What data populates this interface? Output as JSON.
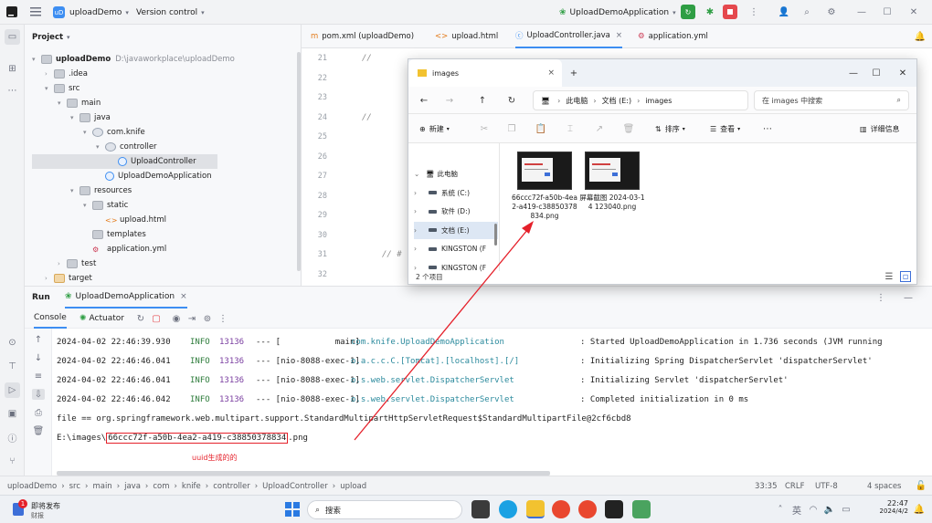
{
  "titlebar": {
    "project_badge": "uD",
    "project_name": "uploadDemo",
    "version_control": "Version control",
    "run_config": "UploadDemoApplication"
  },
  "project_panel": {
    "title": "Project",
    "tree": [
      {
        "label": "uploadDemo",
        "path": "D:\\javaworkplace\\uploadDemo",
        "kind": "folder"
      },
      {
        "label": ".idea",
        "kind": "folder"
      },
      {
        "label": "src",
        "kind": "folder"
      },
      {
        "label": "main",
        "kind": "folder"
      },
      {
        "label": "java",
        "kind": "folder"
      },
      {
        "label": "com.knife",
        "kind": "package"
      },
      {
        "label": "controller",
        "kind": "package"
      },
      {
        "label": "UploadController",
        "kind": "class"
      },
      {
        "label": "UploadDemoApplication",
        "kind": "class"
      },
      {
        "label": "resources",
        "kind": "folder"
      },
      {
        "label": "static",
        "kind": "folder"
      },
      {
        "label": "upload.html",
        "kind": "html"
      },
      {
        "label": "templates",
        "kind": "folder"
      },
      {
        "label": "application.yml",
        "kind": "yml"
      },
      {
        "label": "test",
        "kind": "folder"
      },
      {
        "label": "target",
        "kind": "folder"
      }
    ]
  },
  "editor_tabs": [
    {
      "label": "pom.xml (uploadDemo)",
      "active": false
    },
    {
      "label": "upload.html",
      "active": false
    },
    {
      "label": "UploadController.java",
      "active": true
    },
    {
      "label": "application.yml",
      "active": false
    }
  ],
  "editor": {
    "lines": [
      {
        "num": "21",
        "code": "//"
      },
      {
        "num": "22",
        "code": ""
      },
      {
        "num": "23",
        "code": ""
      },
      {
        "num": "24",
        "code": "//"
      },
      {
        "num": "25",
        "code": ""
      },
      {
        "num": "26",
        "code": ""
      },
      {
        "num": "27",
        "code": ""
      },
      {
        "num": "28",
        "code": ""
      },
      {
        "num": "29",
        "code": ""
      },
      {
        "num": "30",
        "code": ""
      },
      {
        "num": "31",
        "code": "// #"
      },
      {
        "num": "32",
        "code": ""
      }
    ]
  },
  "run_panel": {
    "title": "Run",
    "config_tab": "UploadDemoApplication",
    "console_tab": "Console",
    "actuator_tab": "Actuator",
    "logs": [
      {
        "time": "2024-04-02 22:46:39.930",
        "level": "INFO",
        "pid": "13136",
        "sep": "--- [",
        "thread": "           main]",
        "logger": "com.knife.UploadDemoApplication",
        "msg": ": Started UploadDemoApplication in 1.736 seconds (JVM running"
      },
      {
        "time": "2024-04-02 22:46:46.041",
        "level": "INFO",
        "pid": "13136",
        "sep": "--- [",
        "thread": "nio-8088-exec-1]",
        "logger": "o.a.c.c.C.[Tomcat].[localhost].[/]",
        "msg": ": Initializing Spring DispatcherServlet 'dispatcherServlet'"
      },
      {
        "time": "2024-04-02 22:46:46.041",
        "level": "INFO",
        "pid": "13136",
        "sep": "--- [",
        "thread": "nio-8088-exec-1]",
        "logger": "o.s.web.servlet.DispatcherServlet",
        "msg": ": Initializing Servlet 'dispatcherServlet'"
      },
      {
        "time": "2024-04-02 22:46:46.042",
        "level": "INFO",
        "pid": "13136",
        "sep": "--- [",
        "thread": "nio-8088-exec-1]",
        "logger": "o.s.web.servlet.DispatcherServlet",
        "msg": ": Completed initialization in 0 ms"
      }
    ],
    "file_line": "file == org.springframework.web.multipart.support.StandardMultipartHttpServletRequest$StandardMultipartFile@2cf6cbd8",
    "path_prefix": "E:\\images\\",
    "path_uuid": "66ccc72f-a50b-4ea2-a419-c38850378834",
    "path_ext": ".png",
    "annotation": "uuid生成的的"
  },
  "statusbar": {
    "breadcrumbs": [
      "uploadDemo",
      "src",
      "main",
      "java",
      "com",
      "knife",
      "controller",
      "UploadController",
      "upload"
    ],
    "position": "33:35",
    "line_ending": "CRLF",
    "encoding": "UTF-8",
    "indent": "4 spaces"
  },
  "taskbar": {
    "weather_title": "即将发布",
    "weather_sub": "财报",
    "search": "搜索",
    "time": "22:47",
    "date": "2024/4/2",
    "notification_count": "1"
  },
  "explorer": {
    "title": "images",
    "breadcrumbs": [
      "此电脑",
      "文档 (E:)",
      "images"
    ],
    "search_placeholder": "在 images 中搜索",
    "cmd_new": "新建",
    "cmd_sort": "排序",
    "cmd_view": "查看",
    "cmd_details": "详细信息",
    "sidebar": [
      {
        "label": "此电脑",
        "selected": false
      },
      {
        "label": "系统 (C:)",
        "selected": false
      },
      {
        "label": "软件 (D:)",
        "selected": false
      },
      {
        "label": "文档 (E:)",
        "selected": true
      },
      {
        "label": "KINGSTON (F",
        "selected": false
      },
      {
        "label": "KINGSTON (F",
        "selected": false
      }
    ],
    "files": [
      {
        "name": "66ccc72f-a50b-4ea2-a419-c38850378834.png"
      },
      {
        "name": "屏幕截图 2024-03-14 123040.png"
      }
    ],
    "status": "2 个项目"
  }
}
